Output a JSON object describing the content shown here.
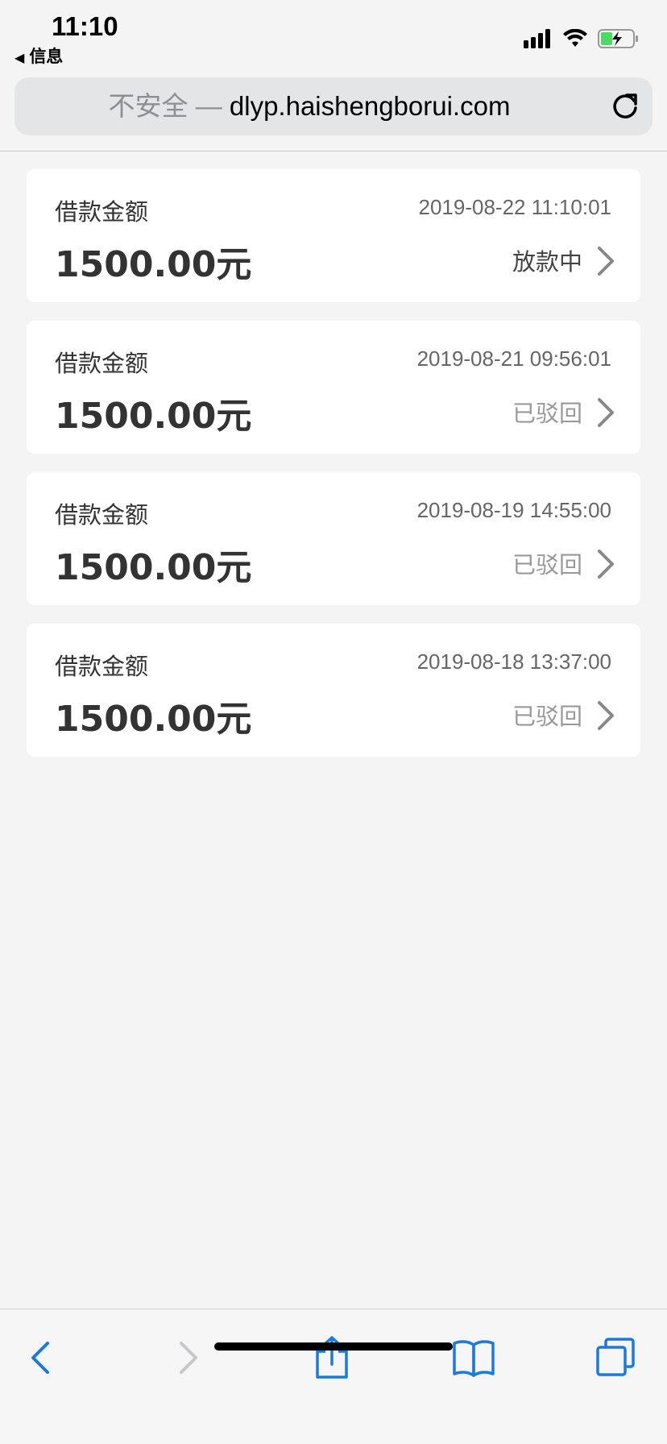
{
  "status_bar": {
    "time": "11:10",
    "back_app": "信息",
    "icons": [
      "signal-icon",
      "wifi-icon",
      "battery-charging-icon"
    ]
  },
  "address_bar": {
    "insecure_label": "不安全 —",
    "domain": "dlyp.haishengborui.com",
    "icon": "reload-icon"
  },
  "loans": [
    {
      "label": "借款金额",
      "date": "2019-08-22 11:10:01",
      "amount": "1500.00元",
      "status": "放款中",
      "status_type": "active"
    },
    {
      "label": "借款金额",
      "date": "2019-08-21 09:56:01",
      "amount": "1500.00元",
      "status": "已驳回",
      "status_type": "rejected"
    },
    {
      "label": "借款金额",
      "date": "2019-08-19 14:55:00",
      "amount": "1500.00元",
      "status": "已驳回",
      "status_type": "rejected"
    },
    {
      "label": "借款金额",
      "date": "2019-08-18 13:37:00",
      "amount": "1500.00元",
      "status": "已驳回",
      "status_type": "rejected"
    }
  ],
  "toolbar": {
    "icons": [
      "back-icon",
      "forward-icon",
      "share-icon",
      "bookmarks-icon",
      "tabs-icon"
    ]
  },
  "colors": {
    "accent": "#1a7ae0",
    "disabled": "#c7c7cc",
    "background": "#f4f4f4"
  }
}
